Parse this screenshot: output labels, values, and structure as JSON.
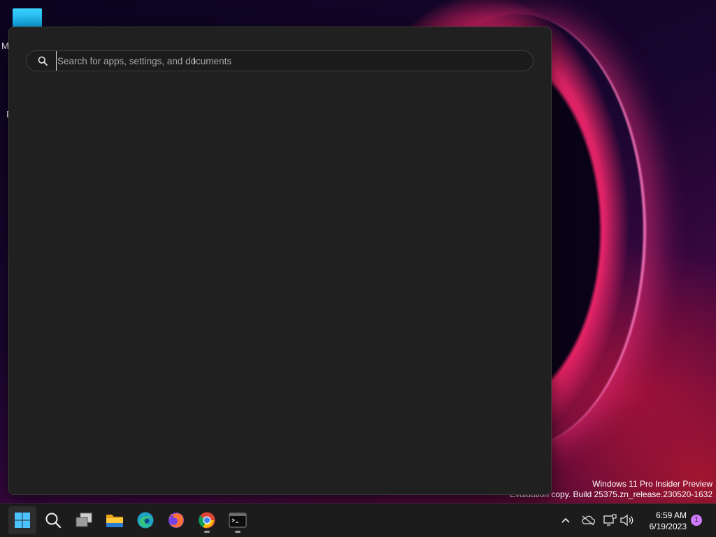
{
  "desktop": {
    "left_letters": [
      "M",
      "F"
    ],
    "watermark": {
      "line1": "Windows 11 Pro Insider Preview",
      "line2": "Evaluation copy. Build 25375.zn_release.230520-1632"
    }
  },
  "search_panel": {
    "search_placeholder": "Search for apps, settings, and documents",
    "search_value": ""
  },
  "taskbar": {
    "apps": [
      {
        "name": "Start",
        "icon": "windows-logo-icon",
        "active": true
      },
      {
        "name": "Search",
        "icon": "search-icon"
      },
      {
        "name": "Task View",
        "icon": "task-view-icon"
      },
      {
        "name": "File Explorer",
        "icon": "folder-icon"
      },
      {
        "name": "Microsoft Edge",
        "icon": "edge-icon"
      },
      {
        "name": "Firefox",
        "icon": "firefox-icon"
      },
      {
        "name": "Google Chrome",
        "icon": "chrome-icon",
        "running": true
      },
      {
        "name": "Terminal",
        "icon": "terminal-icon",
        "running": true
      }
    ],
    "tray": {
      "time": "6:59 AM",
      "date": "6/19/2023",
      "notification_count": "1"
    }
  },
  "colors": {
    "panel_bg": "#202020",
    "taskbar_bg": "#1c1c1c",
    "accent_blue": "#0078d4",
    "notif_badge": "#d07aff"
  }
}
